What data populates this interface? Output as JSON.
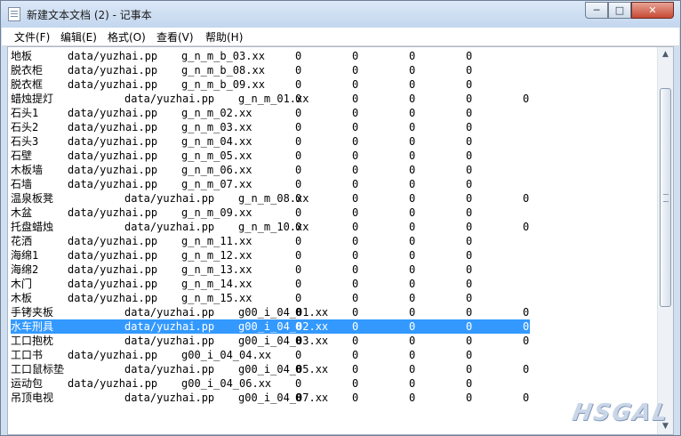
{
  "window": {
    "title": "新建文本文档 (2) - 记事本",
    "controls": {
      "minimize": "─",
      "maximize": "□",
      "close": "✕"
    }
  },
  "menu": [
    "文件(F)",
    "编辑(E)",
    "格式(O)",
    "查看(V)",
    "帮助(H)"
  ],
  "lines": [
    {
      "name": "地板",
      "path": "data/yuzhai.pp",
      "code": "g_n_m_b_03.xx",
      "values": [
        "0",
        "0",
        "0",
        "0"
      ]
    },
    {
      "name": "脱衣柜",
      "path": "data/yuzhai.pp",
      "code": "g_n_m_b_08.xx",
      "values": [
        "0",
        "0",
        "0",
        "0"
      ]
    },
    {
      "name": "脱衣框",
      "path": "data/yuzhai.pp",
      "code": "g_n_m_b_09.xx",
      "values": [
        "0",
        "0",
        "0",
        "0"
      ]
    },
    {
      "name": "蜡烛提灯",
      "path": "data/yuzhai.pp",
      "code": "g_n_m_01.xx",
      "values": [
        "0",
        "0",
        "0",
        "0",
        "0"
      ]
    },
    {
      "name": "石头1",
      "path": "data/yuzhai.pp",
      "code": "g_n_m_02.xx",
      "values": [
        "0",
        "0",
        "0",
        "0"
      ]
    },
    {
      "name": "石头2",
      "path": "data/yuzhai.pp",
      "code": "g_n_m_03.xx",
      "values": [
        "0",
        "0",
        "0",
        "0"
      ]
    },
    {
      "name": "石头3",
      "path": "data/yuzhai.pp",
      "code": "g_n_m_04.xx",
      "values": [
        "0",
        "0",
        "0",
        "0"
      ]
    },
    {
      "name": "石壁",
      "path": "data/yuzhai.pp",
      "code": "g_n_m_05.xx",
      "values": [
        "0",
        "0",
        "0",
        "0"
      ]
    },
    {
      "name": "木板墙",
      "path": "data/yuzhai.pp",
      "code": "g_n_m_06.xx",
      "values": [
        "0",
        "0",
        "0",
        "0"
      ]
    },
    {
      "name": "石墙",
      "path": "data/yuzhai.pp",
      "code": "g_n_m_07.xx",
      "values": [
        "0",
        "0",
        "0",
        "0"
      ]
    },
    {
      "name": "温泉板凳",
      "path": "data/yuzhai.pp",
      "code": "g_n_m_08.xx",
      "values": [
        "0",
        "0",
        "0",
        "0",
        "0"
      ]
    },
    {
      "name": "木盆",
      "path": "data/yuzhai.pp",
      "code": "g_n_m_09.xx",
      "values": [
        "0",
        "0",
        "0",
        "0"
      ]
    },
    {
      "name": "托盘蜡烛",
      "path": "data/yuzhai.pp",
      "code": "g_n_m_10.xx",
      "values": [
        "0",
        "0",
        "0",
        "0",
        "0"
      ]
    },
    {
      "name": "花洒",
      "path": "data/yuzhai.pp",
      "code": "g_n_m_11.xx",
      "values": [
        "0",
        "0",
        "0",
        "0"
      ]
    },
    {
      "name": "海绵1",
      "path": "data/yuzhai.pp",
      "code": "g_n_m_12.xx",
      "values": [
        "0",
        "0",
        "0",
        "0"
      ]
    },
    {
      "name": "海绵2",
      "path": "data/yuzhai.pp",
      "code": "g_n_m_13.xx",
      "values": [
        "0",
        "0",
        "0",
        "0"
      ]
    },
    {
      "name": "木门",
      "path": "data/yuzhai.pp",
      "code": "g_n_m_14.xx",
      "values": [
        "0",
        "0",
        "0",
        "0"
      ]
    },
    {
      "name": "木板",
      "path": "data/yuzhai.pp",
      "code": "g_n_m_15.xx",
      "values": [
        "0",
        "0",
        "0",
        "0"
      ]
    },
    {
      "name": "手铐夹板",
      "path": "data/yuzhai.pp",
      "code": "g00_i_04_01.xx",
      "values": [
        "0",
        "0",
        "0",
        "0",
        "0"
      ]
    },
    {
      "name": "水车刑具",
      "path": "data/yuzhai.pp",
      "code": "g00_i_04_02.xx",
      "values": [
        "0",
        "0",
        "0",
        "0",
        "0"
      ],
      "selected": true
    },
    {
      "name": "工口抱枕",
      "path": "data/yuzhai.pp",
      "code": "g00_i_04_03.xx",
      "values": [
        "0",
        "0",
        "0",
        "0",
        "0"
      ]
    },
    {
      "name": "工口书",
      "path": "data/yuzhai.pp",
      "code": "g00_i_04_04.xx",
      "values": [
        "0",
        "0",
        "0",
        "0"
      ]
    },
    {
      "name": "工口鼠标垫",
      "path": "data/yuzhai.pp",
      "code": "g00_i_04_05.xx",
      "values": [
        "0",
        "0",
        "0",
        "0",
        "0"
      ]
    },
    {
      "name": "运动包",
      "path": "data/yuzhai.pp",
      "code": "g00_i_04_06.xx",
      "values": [
        "0",
        "0",
        "0",
        "0"
      ]
    },
    {
      "name": "吊顶电视",
      "path": "data/yuzhai.pp",
      "code": "g00_i_04_07.xx",
      "values": [
        "0",
        "0",
        "0",
        "0",
        "0"
      ]
    }
  ],
  "watermark": "HSGAL"
}
